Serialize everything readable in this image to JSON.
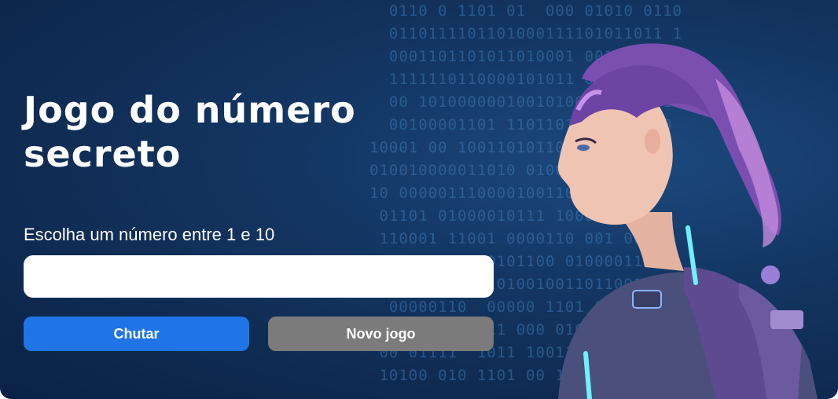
{
  "game": {
    "title": "Jogo do número secreto",
    "prompt": "Escolha um número entre 1 e 10",
    "input": {
      "value": "",
      "placeholder": ""
    },
    "buttons": {
      "guess": "Chutar",
      "new_game": "Novo jogo"
    }
  },
  "decor": {
    "binary_lines": [
      "  0110 0 1101 01  000 01010 0110",
      "  0110111101101000111101011011 1",
      "  0001101101011010001 00111110100",
      "  1111110110000101011 0000000011 0",
      "  00 101000000100101001001 00 1",
      "  00100001101 110110110 0000100",
      "10001 00 100110101100 1 1010 1",
      "010010000011010 010000 101001",
      "10 000001110000100110 10100010",
      " 01101 01000010111 1000 11 01",
      " 110001 11001 0000110 001 0001",
      "  01000010100101100 010000110",
      "  000101001110100100110110011",
      "  00000110  00000 1101 0000",
      "   000100 0011 000 01000 00",
      " 00 01111  1011 1001100 001",
      " 10100 010 1101 00 1010 1"
    ],
    "colors": {
      "background": "#143764",
      "guess_button": "#1f74e6",
      "new_game_button": "#7b7b7b",
      "binary_text": "#3b78b5"
    }
  }
}
